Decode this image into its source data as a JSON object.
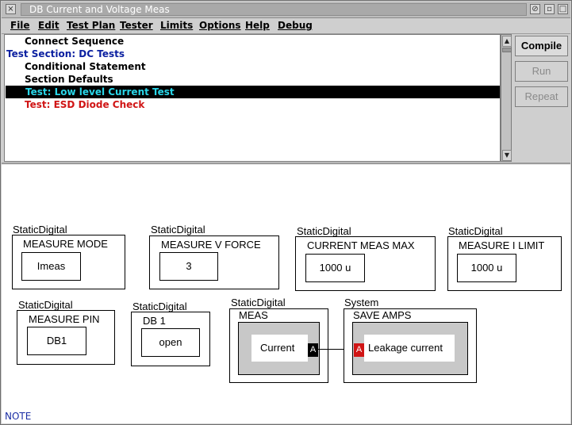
{
  "window": {
    "title": "DB Current and Voltage Meas"
  },
  "menu": [
    "File",
    "Edit",
    "Test Plan",
    "Tester",
    "Limits",
    "Options",
    "Help",
    "Debug"
  ],
  "test_plan": [
    {
      "text": "Connect Sequence",
      "color": "#000000",
      "indent": true
    },
    {
      "text": "Test Section: DC Tests",
      "color": "#0a1fa0",
      "indent": false
    },
    {
      "text": "Conditional Statement",
      "color": "#000000",
      "indent": true
    },
    {
      "text": "Section Defaults",
      "color": "#000000",
      "indent": true
    },
    {
      "text": "Test: Low level Current Test",
      "color": "#29d7ea",
      "indent": true,
      "selected": true
    },
    {
      "text": "Test: ESD Diode Check",
      "color": "#d01515",
      "indent": true
    }
  ],
  "buttons": {
    "compile": "Compile",
    "run": "Run",
    "repeat": "Repeat"
  },
  "blocks": {
    "measure_mode": {
      "type": "StaticDigital",
      "title": "MEASURE MODE",
      "value": "Imeas"
    },
    "measure_v_force": {
      "type": "StaticDigital",
      "title": "MEASURE V FORCE",
      "value": "3"
    },
    "current_meas_max": {
      "type": "StaticDigital",
      "title": "CURRENT MEAS MAX",
      "value": "1000 u"
    },
    "measure_i_limit": {
      "type": "StaticDigital",
      "title": "MEASURE I LIMIT",
      "value": "1000 u"
    },
    "measure_pin": {
      "type": "StaticDigital",
      "title": "MEASURE PIN",
      "value": "DB1"
    },
    "db1": {
      "type": "StaticDigital",
      "title": "DB 1",
      "value": "open"
    },
    "meas": {
      "type": "StaticDigital",
      "title": "MEAS",
      "value": "Current",
      "port": "A"
    },
    "save_amps": {
      "type": "System",
      "title": "SAVE AMPS",
      "value": "Leakage current",
      "port": "A"
    }
  },
  "note": "NOTE",
  "colors": {
    "selection_bg": "#000000",
    "port_out": "#000000",
    "port_in": "#d01515"
  }
}
